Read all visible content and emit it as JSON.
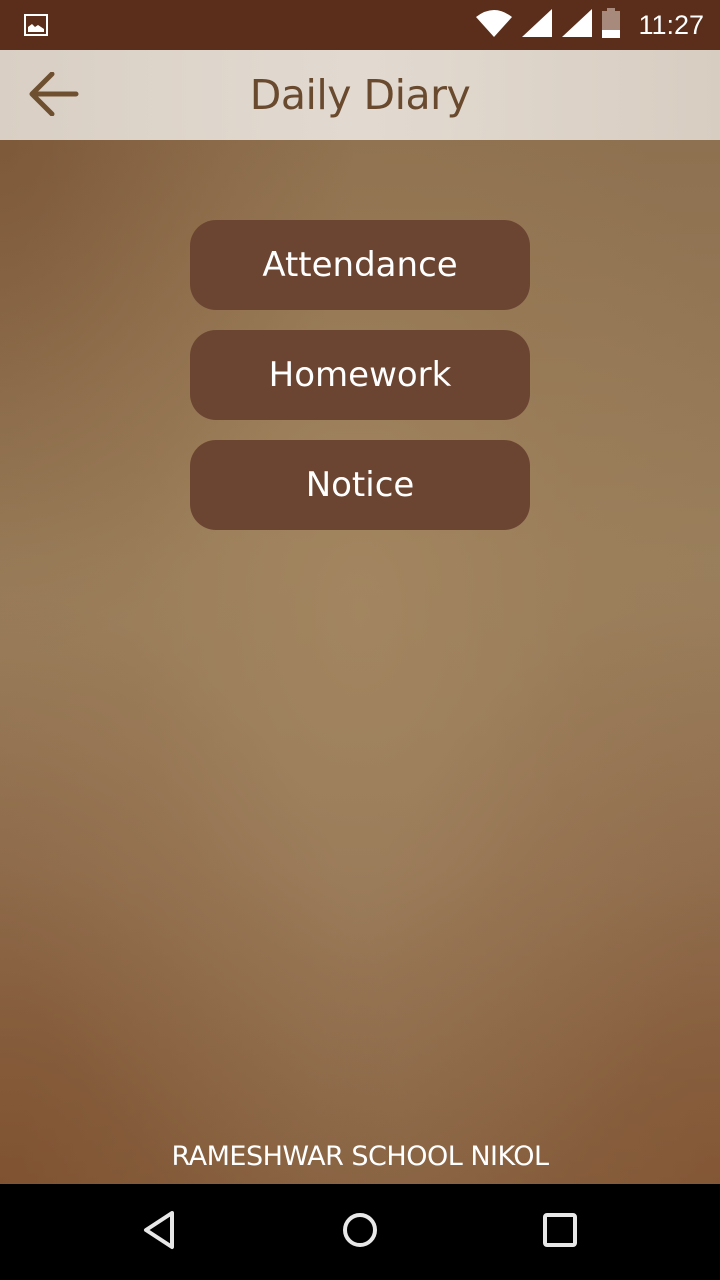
{
  "status_bar": {
    "time": "11:27",
    "icons": [
      "image-notification-icon",
      "wifi-icon",
      "signal-icon",
      "signal-icon",
      "battery-icon"
    ]
  },
  "app_bar": {
    "title": "Daily Diary",
    "back_icon": "arrow-left-icon"
  },
  "menu": {
    "items": [
      {
        "label": "Attendance"
      },
      {
        "label": "Homework"
      },
      {
        "label": "Notice"
      }
    ]
  },
  "footer": {
    "school_name": "RAMESHWAR SCHOOL NIKOL"
  },
  "nav_bar": {
    "icons": [
      "back-triangle-icon",
      "home-circle-icon",
      "recents-square-icon"
    ]
  },
  "colors": {
    "status_bar": "#5a2e1a",
    "button": "#6b4532",
    "title_text": "#6a4a2e"
  }
}
